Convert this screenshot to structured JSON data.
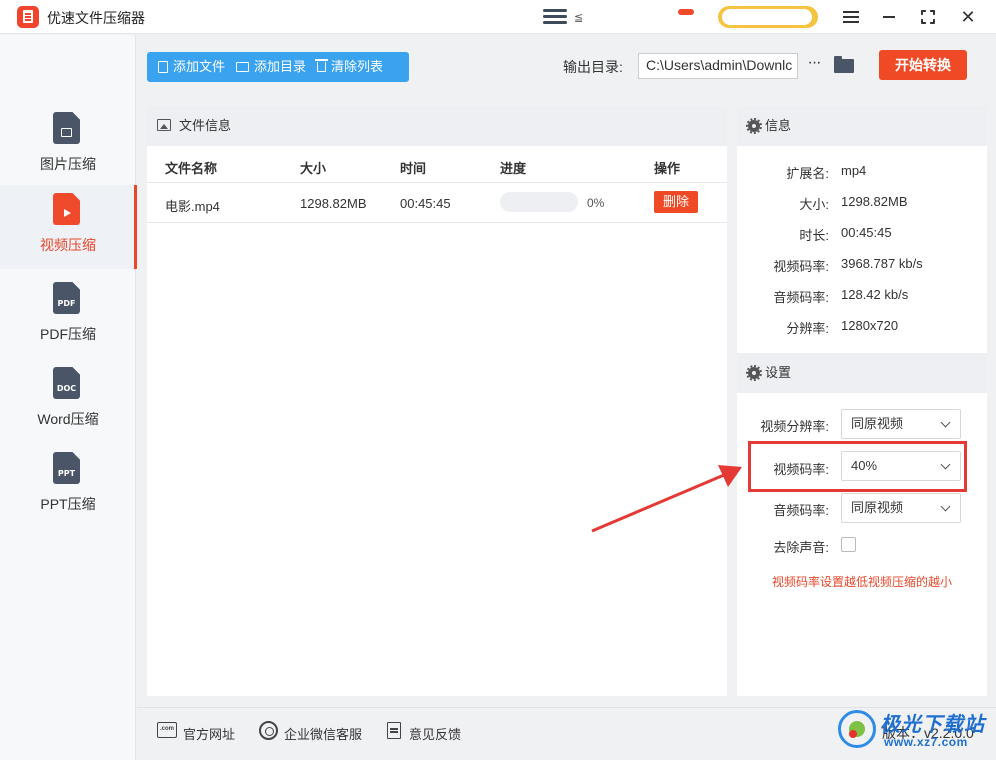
{
  "titlebar": {
    "app_title": "优速文件压缩器",
    "partial_text": "≦"
  },
  "sidebar": {
    "items": [
      {
        "label": "图片压缩",
        "type_text": "",
        "active": false
      },
      {
        "label": "视频压缩",
        "type_text": "",
        "active": true
      },
      {
        "label": "PDF压缩",
        "type_text": "PDF",
        "active": false
      },
      {
        "label": "Word压缩",
        "type_text": "DOC",
        "active": false
      },
      {
        "label": "PPT压缩",
        "type_text": "PPT",
        "active": false
      }
    ]
  },
  "toolbar": {
    "add_file": "添加文件",
    "add_dir": "添加目录",
    "clear_list": "清除列表",
    "output_label": "输出目录:",
    "output_path": "C:\\Users\\admin\\Downlc",
    "more": "···",
    "start": "开始转换"
  },
  "file_panel": {
    "title": "文件信息",
    "columns": {
      "name": "文件名称",
      "size": "大小",
      "time": "时间",
      "progress": "进度",
      "action": "操作"
    },
    "rows": [
      {
        "name": "电影.mp4",
        "size": "1298.82MB",
        "time": "00:45:45",
        "progress_text": "0%",
        "progress_value": 0,
        "action": "删除"
      }
    ]
  },
  "info_panel": {
    "title": "信息",
    "fields": [
      {
        "key": "扩展名:",
        "value": "mp4"
      },
      {
        "key": "大小:",
        "value": "1298.82MB"
      },
      {
        "key": "时长:",
        "value": "00:45:45"
      },
      {
        "key": "视频码率:",
        "value": "3968.787 kb/s"
      },
      {
        "key": "音频码率:",
        "value": "128.42 kb/s"
      },
      {
        "key": "分辨率:",
        "value": "1280x720"
      }
    ]
  },
  "settings": {
    "title": "设置",
    "video_resolution": {
      "label": "视频分辨率:",
      "value": "同原视频"
    },
    "video_bitrate": {
      "label": "视频码率:",
      "value": "40%"
    },
    "audio_bitrate": {
      "label": "音频码率:",
      "value": "同原视频"
    },
    "remove_audio": {
      "label": "去除声音:",
      "checked": false
    },
    "hint": "视频码率设置越低视频压缩的越小"
  },
  "bottombar": {
    "website": "官方网址",
    "website_icon_text": ".com",
    "wechat": "企业微信客服",
    "feedback": "意见反馈",
    "version": "版本：v2.2.0.0"
  },
  "watermark": {
    "text": "极光下载站",
    "url": "www.xz7.com"
  },
  "colors": {
    "accent_red": "#ef4a25",
    "accent_blue": "#3aa3f0",
    "annotation_red": "#e53935"
  }
}
